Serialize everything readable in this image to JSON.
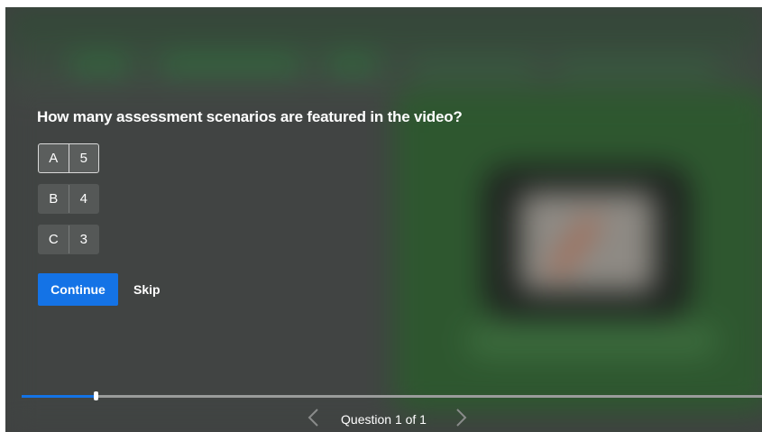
{
  "quiz": {
    "question": "How many assessment scenarios are featured in the video?",
    "options": [
      {
        "letter": "A",
        "text": "5",
        "selected": true
      },
      {
        "letter": "B",
        "text": "4",
        "selected": false
      },
      {
        "letter": "C",
        "text": "3",
        "selected": false
      }
    ],
    "continue_label": "Continue",
    "skip_label": "Skip"
  },
  "progress": {
    "fraction": 0.1
  },
  "navigation": {
    "label": "Question 1 of 1",
    "prev_icon": "chevron-left-icon",
    "next_icon": "chevron-right-icon"
  },
  "colors": {
    "accent": "#1473e6",
    "overlay": "#3f4241",
    "option_bg": "#555857",
    "text": "#ffffff"
  }
}
